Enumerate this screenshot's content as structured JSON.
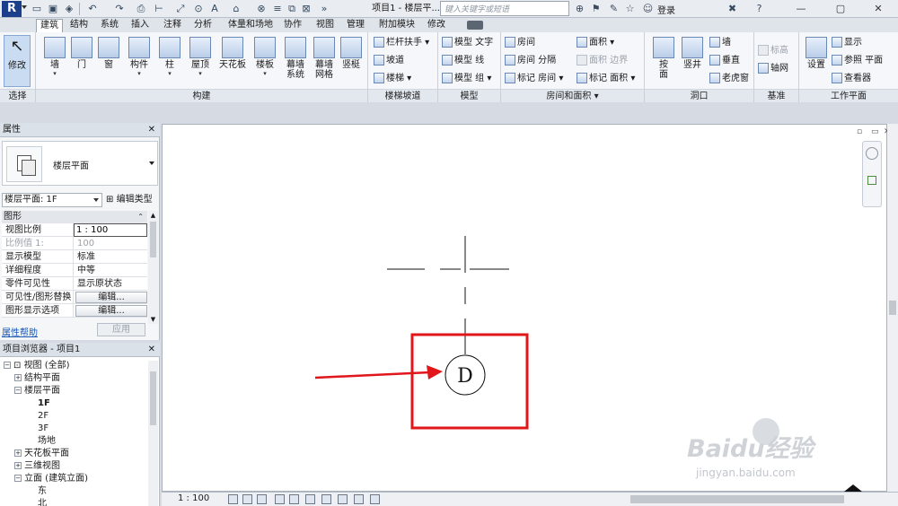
{
  "app": {
    "document_title": "项目1 - 楼层平...",
    "search_placeholder": "键入关键字或短语",
    "login_label": "登录"
  },
  "tabs": [
    "建筑",
    "结构",
    "系统",
    "插入",
    "注释",
    "分析",
    "体量和场地",
    "协作",
    "视图",
    "管理",
    "附加模块",
    "修改"
  ],
  "ribbon": {
    "select": {
      "modify_label": "修改",
      "group_label": "选择"
    },
    "build": {
      "group_label": "构建",
      "buttons": [
        "墙",
        "门",
        "窗",
        "构件",
        "柱",
        "屋顶",
        "天花板",
        "楼板",
        "幕墙\n系统",
        "幕墙\n网格",
        "竖梃"
      ]
    },
    "stairs": {
      "group_label": "楼梯坡道",
      "items": [
        "栏杆扶手",
        "坡道",
        "楼梯"
      ]
    },
    "model": {
      "group_label": "模型",
      "items": [
        "模型 文字",
        "模型 线",
        "模型 组"
      ]
    },
    "room": {
      "group_label": "房间和面积",
      "items": [
        "房间",
        "房间 分隔",
        "标记 房间",
        "面积",
        "面积 边界",
        "标记 面积"
      ]
    },
    "opening": {
      "group_label": "洞口",
      "items": [
        "按\n面",
        "竖井",
        "墙",
        "垂直",
        "老虎窗"
      ]
    },
    "datum": {
      "group_label": "基准",
      "items": [
        "标高",
        "轴网"
      ]
    },
    "workplane": {
      "group_label": "工作平面",
      "items": [
        "设置",
        "显示",
        "参照 平面",
        "查看器"
      ]
    }
  },
  "properties": {
    "title": "属性",
    "type_name": "楼层平面",
    "instance_filter": "楼层平面: 1F",
    "edit_type_label": "编辑类型",
    "section": "图形",
    "rows": [
      {
        "key": "视图比例",
        "value": "1 : 100"
      },
      {
        "key": "比例值 1:",
        "value": "100"
      },
      {
        "key": "显示模型",
        "value": "标准"
      },
      {
        "key": "详细程度",
        "value": "中等"
      },
      {
        "key": "零件可见性",
        "value": "显示原状态"
      },
      {
        "key": "可见性/图形替换",
        "value": "编辑..."
      },
      {
        "key": "图形显示选项",
        "value": "编辑..."
      }
    ],
    "help_label": "属性帮助",
    "apply_label": "应用"
  },
  "browser": {
    "title": "项目浏览器 - 项目1",
    "items": [
      {
        "label": "视图 (全部)",
        "expander": "−",
        "level": 0
      },
      {
        "label": "结构平面",
        "expander": "+",
        "level": 1
      },
      {
        "label": "楼层平面",
        "expander": "−",
        "level": 1
      },
      {
        "label": "1F",
        "level": 2,
        "bold": true
      },
      {
        "label": "2F",
        "level": 2
      },
      {
        "label": "3F",
        "level": 2
      },
      {
        "label": "场地",
        "level": 2
      },
      {
        "label": "天花板平面",
        "expander": "+",
        "level": 1
      },
      {
        "label": "三维视图",
        "expander": "+",
        "level": 1
      },
      {
        "label": "立面 (建筑立面)",
        "expander": "−",
        "level": 1
      },
      {
        "label": "东",
        "level": 2
      },
      {
        "label": "北",
        "level": 2
      }
    ]
  },
  "canvas": {
    "grid_bubble_label": "D",
    "highlight_color": "#e0161b",
    "arrow_color": "#e0161b"
  },
  "status": {
    "scale": "1 : 100"
  },
  "watermark": {
    "brand": "Baidu经验",
    "url": "jingyan.baidu.com"
  }
}
